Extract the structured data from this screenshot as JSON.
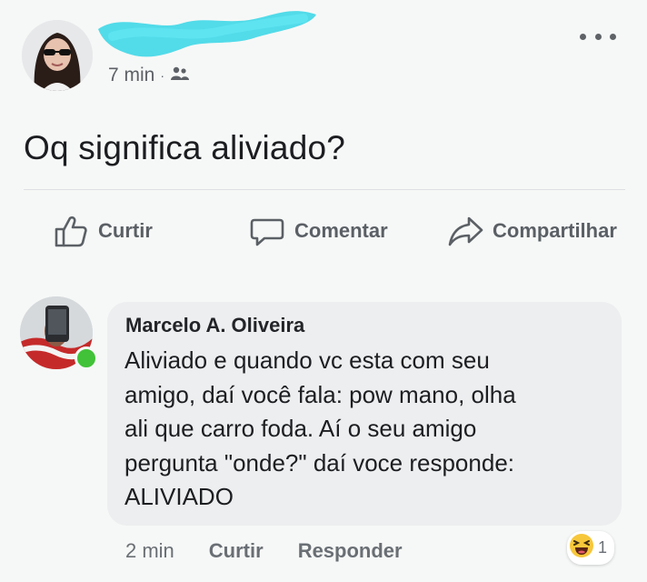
{
  "post": {
    "time": "7 min",
    "separator": "·",
    "audience_icon": "friends-icon",
    "menu_icon": "more-options-icon",
    "text": "Oq significa aliviado?"
  },
  "actions": {
    "like": "Curtir",
    "comment": "Comentar",
    "share": "Compartilhar"
  },
  "comment": {
    "author": "Marcelo A. Oliveira",
    "text": "Aliviado e quando vc esta com seu\namigo, daí você fala: pow mano, olha\nali que carro foda. Aí o seu amigo\npergunta \"onde?\" daí voce responde:\nALIVIADO",
    "time": "2 min",
    "like": "Curtir",
    "reply": "Responder",
    "reaction_count": "1",
    "reaction_icon": "haha-emoji-icon"
  },
  "colors": {
    "background": "#f6f8f7",
    "bubble": "#eceeef",
    "name_redaction": "#49d9e8",
    "online": "#41c238",
    "secondary_text": "#5b6066"
  }
}
